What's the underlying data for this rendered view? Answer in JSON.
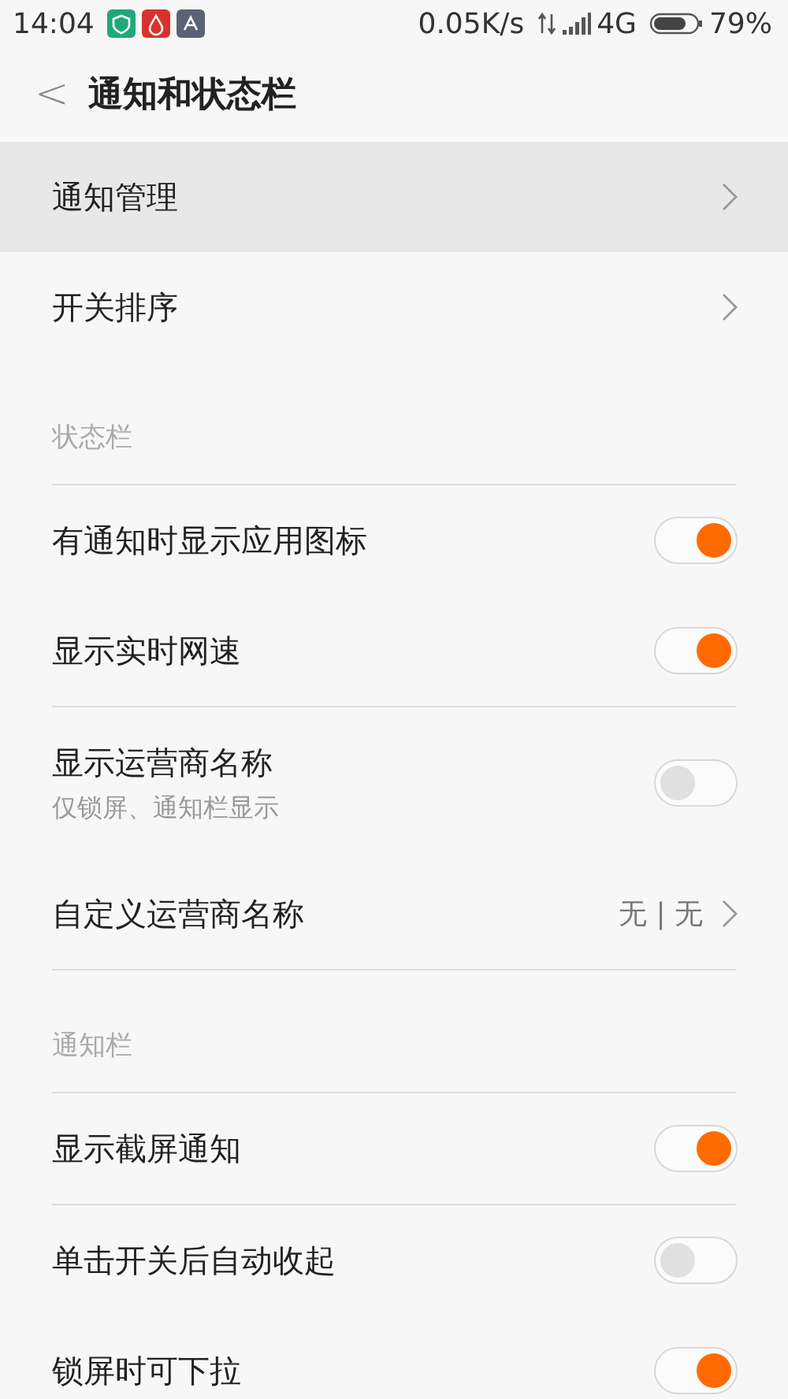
{
  "status_bar": {
    "time": "14:04",
    "speed": "0.05K/s",
    "network": "4G",
    "battery": "79%"
  },
  "header": {
    "back": "<",
    "title": "通知和状态栏"
  },
  "top_items": [
    {
      "label": "通知管理",
      "selected": true
    },
    {
      "label": "开关排序",
      "selected": false
    }
  ],
  "sections": [
    {
      "title": "状态栏",
      "groups": [
        [
          {
            "kind": "toggle",
            "label": "有通知时显示应用图标",
            "on": true
          },
          {
            "kind": "toggle",
            "label": "显示实时网速",
            "on": true
          }
        ],
        [
          {
            "kind": "toggle",
            "label": "显示运营商名称",
            "subtitle": "仅锁屏、通知栏显示",
            "on": false
          },
          {
            "kind": "link",
            "label": "自定义运营商名称",
            "value": "无 | 无"
          }
        ]
      ]
    },
    {
      "title": "通知栏",
      "groups": [
        [
          {
            "kind": "toggle",
            "label": "显示截屏通知",
            "on": true
          }
        ],
        [
          {
            "kind": "toggle",
            "label": "单击开关后自动收起",
            "on": false
          },
          {
            "kind": "toggle",
            "label": "锁屏时可下拉",
            "on": true
          }
        ]
      ]
    }
  ]
}
